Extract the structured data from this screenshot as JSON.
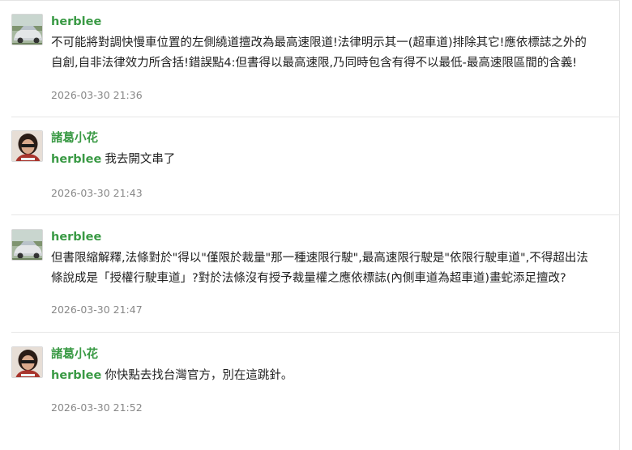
{
  "comments": [
    {
      "author": "herblee",
      "avatar": "car-avatar",
      "mention": "",
      "text_line1": "不可能將對調快慢車位置的左側繞道擅改為最高速限道!法律明示其一(超車道)排除其它!應依標誌之外的",
      "text_line2": "自創,自非法律效力所含括!錯誤點4:但書得以最高速限,乃同時包含有得不以最低-最高速限區間的含義!",
      "time": "2026-03-30 21:36"
    },
    {
      "author": "諸葛小花",
      "avatar": "person-avatar",
      "mention": "herblee",
      "text_line1": "我去開文串了",
      "text_line2": "",
      "time": "2026-03-30 21:43"
    },
    {
      "author": "herblee",
      "avatar": "car-avatar",
      "mention": "",
      "text_line1": "但書限縮解釋,法條對於\"得以\"僅限於裁量\"那一種速限行駛\",最高速限行駛是\"依限行駛車道\",不得超出法",
      "text_line2": "條說成是「授權行駛車道」?對於法條沒有授予裁量權之應依標誌(內側車道為超車道)畫蛇添足擅改?",
      "time": "2026-03-30 21:47"
    },
    {
      "author": "諸葛小花",
      "avatar": "person-avatar",
      "mention": "herblee",
      "text_line1": "你快點去找台灣官方，別在這跳針。",
      "text_line2": "",
      "time": "2026-03-30 21:52"
    }
  ],
  "colors": {
    "author": "#3a9a45",
    "text": "#222222",
    "time": "#888888",
    "divider": "#e6e6e6"
  }
}
